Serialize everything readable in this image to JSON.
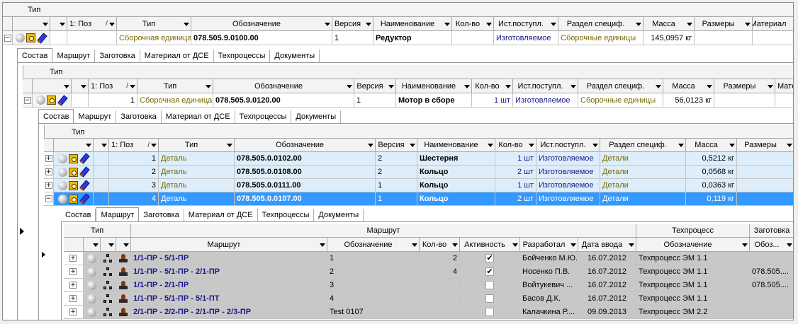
{
  "level1": {
    "type_header": "Тип",
    "columns": [
      "1: Поз",
      "Тип",
      "Обозначение",
      "Версия",
      "Наименование",
      "Кол-во",
      "Ист.поступл.",
      "Раздел специф.",
      "Масса",
      "Размеры",
      "Материал"
    ],
    "row": {
      "pos": "",
      "type": "Сборочная единица",
      "designation": "078.505.9.0100.00",
      "version": "1",
      "name": "Редуктор",
      "qty": "",
      "source": "Изготовляемое",
      "section": "Сборочные единицы",
      "mass": "145,0957 кг",
      "size": "",
      "material": ""
    },
    "tabs": [
      "Состав",
      "Маршрут",
      "Заготовка",
      "Материал от ДСЕ",
      "Техпроцессы",
      "Документы"
    ]
  },
  "level2": {
    "type_header": "Тип",
    "columns": [
      "1: Поз",
      "Тип",
      "Обозначение",
      "Версия",
      "Наименование",
      "Кол-во",
      "Ист.поступл.",
      "Раздел специф.",
      "Масса",
      "Размеры",
      "Мате"
    ],
    "row": {
      "pos": "1",
      "type": "Сборочная единица",
      "designation": "078.505.9.0120.00",
      "version": "1",
      "name": "Мотор в сборе",
      "qty": "1 шт",
      "source": "Изготовляемое",
      "section": "Сборочные единицы",
      "mass": "56,0123 кг",
      "size": ""
    },
    "tabs": [
      "Состав",
      "Маршрут",
      "Заготовка",
      "Материал от ДСЕ",
      "Техпроцессы",
      "Документы"
    ]
  },
  "level3": {
    "type_header": "Тип",
    "columns": [
      "1: Поз",
      "Тип",
      "Обозначение",
      "Версия",
      "Наименование",
      "Кол-во",
      "Ист.поступл.",
      "Раздел специф.",
      "Масса",
      "Размеры"
    ],
    "rows": [
      {
        "pos": "1",
        "type": "Деталь",
        "designation": "078.505.0.0102.00",
        "version": "2",
        "name": "Шестерня",
        "qty": "1 шт",
        "source": "Изготовляемое",
        "section": "Детали",
        "mass": "0,5212 кг"
      },
      {
        "pos": "2",
        "type": "Деталь",
        "designation": "078.505.0.0108.00",
        "version": "2",
        "name": "Кольцо",
        "qty": "2 шт",
        "source": "Изготовляемое",
        "section": "Детали",
        "mass": "0,0568 кг"
      },
      {
        "pos": "3",
        "type": "Деталь",
        "designation": "078.505.0.0111.00",
        "version": "1",
        "name": "Кольцо",
        "qty": "1 шт",
        "source": "Изготовляемое",
        "section": "Детали",
        "mass": "0,0363 кг"
      },
      {
        "pos": "4",
        "type": "Деталь",
        "designation": "078.505.0.0107.00",
        "version": "1",
        "name": "Кольцо",
        "qty": "2 шт",
        "source": "Изготовляемое",
        "section": "Детали",
        "mass": "0,119 кг"
      }
    ],
    "tabs": [
      "Состав",
      "Маршрут",
      "Заготовка",
      "Материал от ДСЕ",
      "Техпроцессы",
      "Документы"
    ],
    "active_tab": "Маршрут"
  },
  "route": {
    "group_headers": {
      "type": "Тип",
      "route": "Маршрут",
      "process": "Техпроцесс",
      "blank": "Заготовка"
    },
    "columns": {
      "route": "Маршрут",
      "designation": "Обозначение",
      "qty": "Кол-во",
      "active": "Активность",
      "developer": "Разработал",
      "date": "Дата ввода",
      "process_designation": "Обозначение",
      "blank_designation": "Обоз..."
    },
    "rows": [
      {
        "route": "1/1-ПР - 5/1-ПР",
        "designation": "1",
        "qty": "2",
        "active": true,
        "developer": "Бойченко М.Ю.",
        "date": "16.07.2012",
        "process": "Техпроцесс ЭМ 1.1",
        "blank": ""
      },
      {
        "route": "1/1-ПР - 5/1-ПР - 2/1-ПР",
        "designation": "2",
        "qty": "4",
        "active": true,
        "developer": "Носенко П.В.",
        "date": "16.07.2012",
        "process": "Техпроцесс ЭМ 1.1",
        "blank": "078.505...."
      },
      {
        "route": "1/1-ПР - 2/1-ПР",
        "designation": "3",
        "qty": "",
        "active": false,
        "developer": "Войтукевич ...",
        "date": "16.07.2012",
        "process": "Техпроцесс ЭМ 1.1",
        "blank": "078.505...."
      },
      {
        "route": "1/1-ПР - 5/1-ПР - 5/1-ПТ",
        "designation": "4",
        "qty": "",
        "active": false,
        "developer": "Басов Д.К.",
        "date": "16.07.2012",
        "process": "Техпроцесс ЭМ 1.1",
        "blank": ""
      },
      {
        "route": "2/1-ПР - 2/2-ПР - 2/1-ПР - 2/3-ПР",
        "designation": "Test 0107",
        "qty": "",
        "active": false,
        "developer": "Калачкина Р....",
        "date": "09.09.2013",
        "process": "Техпроцесс ЭМ 2.2",
        "blank": ""
      }
    ]
  },
  "icons": {
    "expand": "plus-expander",
    "collapse": "minus-expander",
    "status": "grey-ball-icon",
    "lock": "lock-icon",
    "edit": "pencil-icon",
    "route": "tree-network-icon",
    "stamp": "stamp-icon"
  },
  "colors": {
    "selected_row": "#3399ff",
    "light_row": "#ddeefa",
    "route_row": "#c8c8c8",
    "olive_text": "#7a6a00",
    "blue_text": "#1a1a8c"
  }
}
